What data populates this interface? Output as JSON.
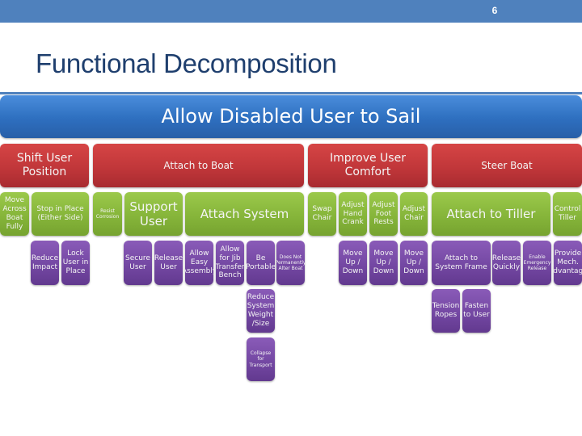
{
  "header": {
    "slide_number": "6",
    "title": "Functional Decomposition"
  },
  "colors": {
    "header_bar": "#4f81bd",
    "title_text": "#1f3f6e",
    "level0": "#2e6fbf",
    "level1": "#c1373a",
    "level2": "#86b53a",
    "level3": "#7448a3"
  },
  "diagram": {
    "root": "Allow Disabled User to Sail",
    "level1": [
      "Shift User Position",
      "Attach to Boat",
      "Improve User Comfort",
      "Steer Boat"
    ],
    "level2": [
      "Move Across Boat Fully",
      "Stop in Place (Either Side)",
      "Resist Corrosion",
      "Support User",
      "Attach System",
      "Swap Chair",
      "Adjust Hand Crank",
      "Adjust Foot Rests",
      "Adjust Chair",
      "Attach to Tiller",
      "Control Tiller"
    ],
    "level3": [
      "Reduce Impact",
      "Lock User in Place",
      "Secure User",
      "Release User",
      "Allow Easy Assembly",
      "Allow for Jib Transfer Bench",
      "Be Portable",
      "Does Not Permanently Alter Boat",
      "Move Up / Down",
      "Move Up / Down",
      "Move Up / Down",
      "Attach to System Frame",
      "Release Quickly",
      "Enable Emergency Release",
      "Provide Mech. Advantage"
    ],
    "level4": [
      "Reduce System Weight /Size",
      "Tension Ropes",
      "Fasten to User"
    ],
    "level5": [
      "Collapse for Transport"
    ]
  }
}
